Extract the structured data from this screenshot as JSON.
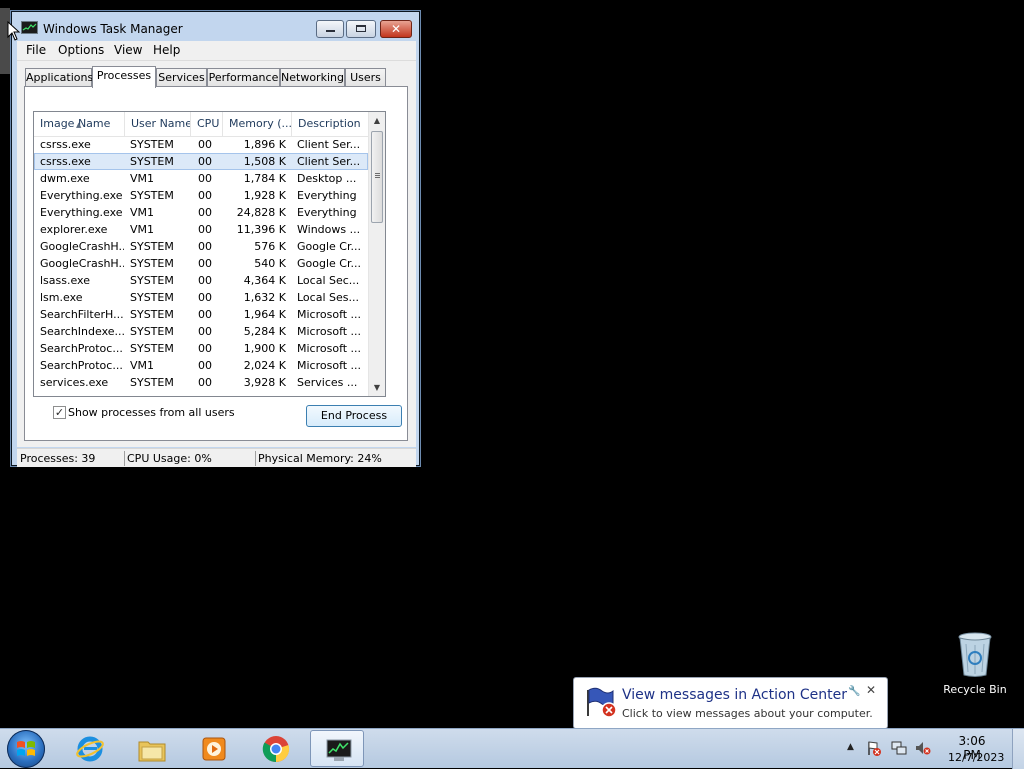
{
  "window": {
    "title": "Windows Task Manager",
    "close_glyph": "✕"
  },
  "menu": [
    "File",
    "Options",
    "View",
    "Help"
  ],
  "tabs": [
    "Applications",
    "Processes",
    "Services",
    "Performance",
    "Networking",
    "Users"
  ],
  "active_tab": "Processes",
  "columns": [
    "Image Name",
    "User Name",
    "CPU",
    "Memory (...",
    "Description"
  ],
  "processes": [
    {
      "name": "csrss.exe",
      "user": "SYSTEM",
      "cpu": "00",
      "mem": "1,896 K",
      "desc": "Client Ser..."
    },
    {
      "name": "csrss.exe",
      "user": "SYSTEM",
      "cpu": "00",
      "mem": "1,508 K",
      "desc": "Client Ser..."
    },
    {
      "name": "dwm.exe",
      "user": "VM1",
      "cpu": "00",
      "mem": "1,784 K",
      "desc": "Desktop ..."
    },
    {
      "name": "Everything.exe",
      "user": "SYSTEM",
      "cpu": "00",
      "mem": "1,928 K",
      "desc": "Everything"
    },
    {
      "name": "Everything.exe",
      "user": "VM1",
      "cpu": "00",
      "mem": "24,828 K",
      "desc": "Everything"
    },
    {
      "name": "explorer.exe",
      "user": "VM1",
      "cpu": "00",
      "mem": "11,396 K",
      "desc": "Windows ..."
    },
    {
      "name": "GoogleCrashH...",
      "user": "SYSTEM",
      "cpu": "00",
      "mem": "576 K",
      "desc": "Google Cr..."
    },
    {
      "name": "GoogleCrashH...",
      "user": "SYSTEM",
      "cpu": "00",
      "mem": "540 K",
      "desc": "Google Cr..."
    },
    {
      "name": "lsass.exe",
      "user": "SYSTEM",
      "cpu": "00",
      "mem": "4,364 K",
      "desc": "Local Sec..."
    },
    {
      "name": "lsm.exe",
      "user": "SYSTEM",
      "cpu": "00",
      "mem": "1,632 K",
      "desc": "Local Ses..."
    },
    {
      "name": "SearchFilterH...",
      "user": "SYSTEM",
      "cpu": "00",
      "mem": "1,964 K",
      "desc": "Microsoft ..."
    },
    {
      "name": "SearchIndexe...",
      "user": "SYSTEM",
      "cpu": "00",
      "mem": "5,284 K",
      "desc": "Microsoft ..."
    },
    {
      "name": "SearchProtoc...",
      "user": "SYSTEM",
      "cpu": "00",
      "mem": "1,900 K",
      "desc": "Microsoft ..."
    },
    {
      "name": "SearchProtoc...",
      "user": "VM1",
      "cpu": "00",
      "mem": "2,024 K",
      "desc": "Microsoft ..."
    },
    {
      "name": "services.exe",
      "user": "SYSTEM",
      "cpu": "00",
      "mem": "3,928 K",
      "desc": "Services ..."
    }
  ],
  "selected_row": 1,
  "show_all_users": {
    "label": "Show processes from all users",
    "checked": true,
    "glyph": "✓"
  },
  "end_process_label": "End Process",
  "status": {
    "processes": "Processes: 39",
    "cpu": "CPU Usage: 0%",
    "memory": "Physical Memory: 24%"
  },
  "desktop": {
    "recycle_bin_label": "Recycle Bin"
  },
  "balloon": {
    "title": "View messages in Action Center",
    "text": "Click to view messages about your computer.",
    "close_glyph": "✕",
    "wrench_glyph": "🔧"
  },
  "taskbar": {
    "apps": [
      "internet-explorer",
      "windows-explorer",
      "windows-media-player",
      "google-chrome",
      "task-manager"
    ],
    "active_app": "task-manager",
    "tray_arrow": "▲",
    "clock_time": "3:06 PM",
    "clock_date": "12/7/2023"
  },
  "colors": {
    "desktop": "#000000",
    "taskbar": "#c3d4e8",
    "selection": "#dce9f8",
    "balloon_title": "#1e3287",
    "close_button": "#c2351c"
  }
}
